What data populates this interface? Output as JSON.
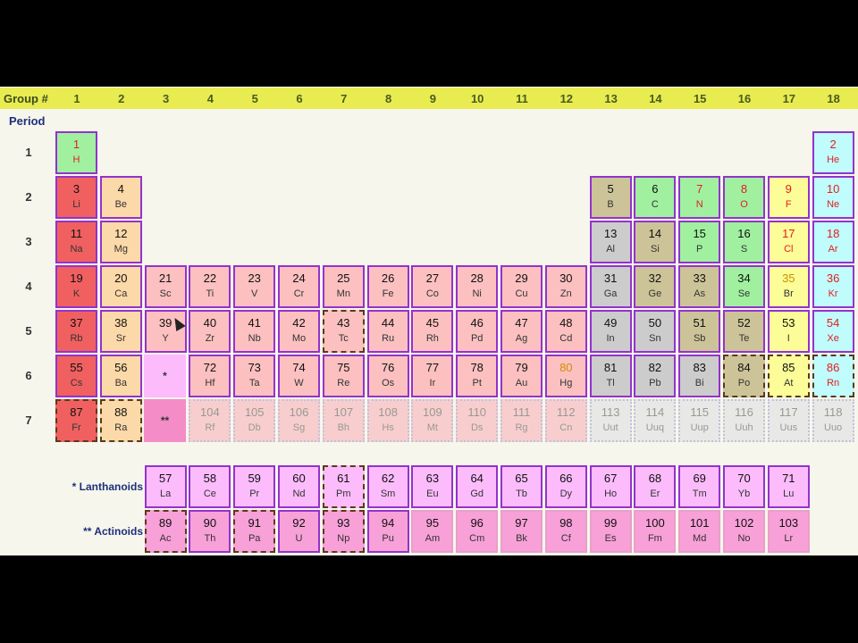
{
  "header": {
    "group_title": "Group #",
    "groups": [
      "1",
      "2",
      "3",
      "4",
      "5",
      "6",
      "7",
      "8",
      "9",
      "10",
      "11",
      "12",
      "13",
      "14",
      "15",
      "16",
      "17",
      "18"
    ]
  },
  "periods": {
    "title": "Period",
    "labels": [
      "1",
      "2",
      "3",
      "4",
      "5",
      "6",
      "7"
    ]
  },
  "series": {
    "lanthanoid_marker": "*",
    "actinoid_marker": "**",
    "lanthanoids_label": "* Lanthanoids",
    "actinoids_label": "** Actinoids"
  },
  "elements": [
    [
      1,
      "H",
      1,
      1,
      "nonmetal",
      "g",
      "solid"
    ],
    [
      2,
      "He",
      18,
      1,
      "noble",
      "g",
      "solid"
    ],
    [
      3,
      "Li",
      1,
      2,
      "alkali",
      "s",
      "solid"
    ],
    [
      4,
      "Be",
      2,
      2,
      "alkaline",
      "s",
      "solid"
    ],
    [
      5,
      "B",
      13,
      2,
      "metalloid",
      "s",
      "solid"
    ],
    [
      6,
      "C",
      14,
      2,
      "nonmetal",
      "s",
      "solid"
    ],
    [
      7,
      "N",
      15,
      2,
      "nonmetal",
      "g",
      "solid"
    ],
    [
      8,
      "O",
      16,
      2,
      "nonmetal",
      "g",
      "solid"
    ],
    [
      9,
      "F",
      17,
      2,
      "halogen",
      "g",
      "solid"
    ],
    [
      10,
      "Ne",
      18,
      2,
      "noble",
      "g",
      "solid"
    ],
    [
      11,
      "Na",
      1,
      3,
      "alkali",
      "s",
      "solid"
    ],
    [
      12,
      "Mg",
      2,
      3,
      "alkaline",
      "s",
      "solid"
    ],
    [
      13,
      "Al",
      13,
      3,
      "post",
      "s",
      "solid"
    ],
    [
      14,
      "Si",
      14,
      3,
      "metalloid",
      "s",
      "solid"
    ],
    [
      15,
      "P",
      15,
      3,
      "nonmetal",
      "s",
      "solid"
    ],
    [
      16,
      "S",
      16,
      3,
      "nonmetal",
      "s",
      "solid"
    ],
    [
      17,
      "Cl",
      17,
      3,
      "halogen",
      "g",
      "solid"
    ],
    [
      18,
      "Ar",
      18,
      3,
      "noble",
      "g",
      "solid"
    ],
    [
      19,
      "K",
      1,
      4,
      "alkali",
      "s",
      "solid"
    ],
    [
      20,
      "Ca",
      2,
      4,
      "alkaline",
      "s",
      "solid"
    ],
    [
      21,
      "Sc",
      3,
      4,
      "transition",
      "s",
      "solid"
    ],
    [
      22,
      "Ti",
      4,
      4,
      "transition",
      "s",
      "solid"
    ],
    [
      23,
      "V",
      5,
      4,
      "transition",
      "s",
      "solid"
    ],
    [
      24,
      "Cr",
      6,
      4,
      "transition",
      "s",
      "solid"
    ],
    [
      25,
      "Mn",
      7,
      4,
      "transition",
      "s",
      "solid"
    ],
    [
      26,
      "Fe",
      8,
      4,
      "transition",
      "s",
      "solid"
    ],
    [
      27,
      "Co",
      9,
      4,
      "transition",
      "s",
      "solid"
    ],
    [
      28,
      "Ni",
      10,
      4,
      "transition",
      "s",
      "solid"
    ],
    [
      29,
      "Cu",
      11,
      4,
      "transition",
      "s",
      "solid"
    ],
    [
      30,
      "Zn",
      12,
      4,
      "transition",
      "s",
      "solid"
    ],
    [
      31,
      "Ga",
      13,
      4,
      "post",
      "s",
      "solid"
    ],
    [
      32,
      "Ge",
      14,
      4,
      "metalloid",
      "s",
      "solid"
    ],
    [
      33,
      "As",
      15,
      4,
      "metalloid",
      "s",
      "solid"
    ],
    [
      34,
      "Se",
      16,
      4,
      "nonmetal",
      "s",
      "solid"
    ],
    [
      35,
      "Br",
      17,
      4,
      "halogen",
      "l",
      "solid"
    ],
    [
      36,
      "Kr",
      18,
      4,
      "noble",
      "g",
      "solid"
    ],
    [
      37,
      "Rb",
      1,
      5,
      "alkali",
      "s",
      "solid"
    ],
    [
      38,
      "Sr",
      2,
      5,
      "alkaline",
      "s",
      "solid"
    ],
    [
      39,
      "Y",
      3,
      5,
      "transition",
      "s",
      "solid"
    ],
    [
      40,
      "Zr",
      4,
      5,
      "transition",
      "s",
      "solid"
    ],
    [
      41,
      "Nb",
      5,
      5,
      "transition",
      "s",
      "solid"
    ],
    [
      42,
      "Mo",
      6,
      5,
      "transition",
      "s",
      "solid"
    ],
    [
      43,
      "Tc",
      7,
      5,
      "transition",
      "s",
      "dashed"
    ],
    [
      44,
      "Ru",
      8,
      5,
      "transition",
      "s",
      "solid"
    ],
    [
      45,
      "Rh",
      9,
      5,
      "transition",
      "s",
      "solid"
    ],
    [
      46,
      "Pd",
      10,
      5,
      "transition",
      "s",
      "solid"
    ],
    [
      47,
      "Ag",
      11,
      5,
      "transition",
      "s",
      "solid"
    ],
    [
      48,
      "Cd",
      12,
      5,
      "transition",
      "s",
      "solid"
    ],
    [
      49,
      "In",
      13,
      5,
      "post",
      "s",
      "solid"
    ],
    [
      50,
      "Sn",
      14,
      5,
      "post",
      "s",
      "solid"
    ],
    [
      51,
      "Sb",
      15,
      5,
      "metalloid",
      "s",
      "solid"
    ],
    [
      52,
      "Te",
      16,
      5,
      "metalloid",
      "s",
      "solid"
    ],
    [
      53,
      "I",
      17,
      5,
      "halogen",
      "s",
      "solid"
    ],
    [
      54,
      "Xe",
      18,
      5,
      "noble",
      "g",
      "solid"
    ],
    [
      55,
      "Cs",
      1,
      6,
      "alkali",
      "s",
      "solid"
    ],
    [
      56,
      "Ba",
      2,
      6,
      "alkaline",
      "s",
      "solid"
    ],
    [
      72,
      "Hf",
      4,
      6,
      "transition",
      "s",
      "solid"
    ],
    [
      73,
      "Ta",
      5,
      6,
      "transition",
      "s",
      "solid"
    ],
    [
      74,
      "W",
      6,
      6,
      "transition",
      "s",
      "solid"
    ],
    [
      75,
      "Re",
      7,
      6,
      "transition",
      "s",
      "solid"
    ],
    [
      76,
      "Os",
      8,
      6,
      "transition",
      "s",
      "solid"
    ],
    [
      77,
      "Ir",
      9,
      6,
      "transition",
      "s",
      "solid"
    ],
    [
      78,
      "Pt",
      10,
      6,
      "transition",
      "s",
      "solid"
    ],
    [
      79,
      "Au",
      11,
      6,
      "transition",
      "s",
      "solid"
    ],
    [
      80,
      "Hg",
      12,
      6,
      "transition",
      "l",
      "solid"
    ],
    [
      81,
      "Tl",
      13,
      6,
      "post",
      "s",
      "solid"
    ],
    [
      82,
      "Pb",
      14,
      6,
      "post",
      "s",
      "solid"
    ],
    [
      83,
      "Bi",
      15,
      6,
      "post",
      "s",
      "solid"
    ],
    [
      84,
      "Po",
      16,
      6,
      "metalloid",
      "s",
      "dashed"
    ],
    [
      85,
      "At",
      17,
      6,
      "halogen",
      "s",
      "dashed"
    ],
    [
      86,
      "Rn",
      18,
      6,
      "noble",
      "g",
      "dashed"
    ],
    [
      87,
      "Fr",
      1,
      7,
      "alkali",
      "s",
      "dashed"
    ],
    [
      88,
      "Ra",
      2,
      7,
      "alkaline",
      "s",
      "dashed"
    ],
    [
      104,
      "Rf",
      4,
      7,
      "trans7",
      "u",
      "dotted"
    ],
    [
      105,
      "Db",
      5,
      7,
      "trans7",
      "u",
      "dotted"
    ],
    [
      106,
      "Sg",
      6,
      7,
      "trans7",
      "u",
      "dotted"
    ],
    [
      107,
      "Bh",
      7,
      7,
      "trans7",
      "u",
      "dotted"
    ],
    [
      108,
      "Hs",
      8,
      7,
      "trans7",
      "u",
      "dotted"
    ],
    [
      109,
      "Mt",
      9,
      7,
      "trans7",
      "u",
      "dotted"
    ],
    [
      110,
      "Ds",
      10,
      7,
      "trans7",
      "u",
      "dotted"
    ],
    [
      111,
      "Rg",
      11,
      7,
      "trans7",
      "u",
      "dotted"
    ],
    [
      112,
      "Cn",
      12,
      7,
      "trans7",
      "u",
      "dotted"
    ],
    [
      113,
      "Uut",
      13,
      7,
      "unknown",
      "u",
      "dotted"
    ],
    [
      114,
      "Uuq",
      14,
      7,
      "unknown",
      "u",
      "dotted"
    ],
    [
      115,
      "Uup",
      15,
      7,
      "unknown",
      "u",
      "dotted"
    ],
    [
      116,
      "Uuh",
      16,
      7,
      "unknown",
      "u",
      "dotted"
    ],
    [
      117,
      "Uus",
      17,
      7,
      "unknown",
      "u",
      "dotted"
    ],
    [
      118,
      "Uuo",
      18,
      7,
      "unknown",
      "u",
      "dotted"
    ],
    [
      57,
      "La",
      3,
      "L",
      "lanth",
      "s",
      "solid"
    ],
    [
      58,
      "Ce",
      4,
      "L",
      "lanth",
      "s",
      "solid"
    ],
    [
      59,
      "Pr",
      5,
      "L",
      "lanth",
      "s",
      "solid"
    ],
    [
      60,
      "Nd",
      6,
      "L",
      "lanth",
      "s",
      "solid"
    ],
    [
      61,
      "Pm",
      7,
      "L",
      "lanth",
      "s",
      "dashed"
    ],
    [
      62,
      "Sm",
      8,
      "L",
      "lanth",
      "s",
      "solid"
    ],
    [
      63,
      "Eu",
      9,
      "L",
      "lanth",
      "s",
      "solid"
    ],
    [
      64,
      "Gd",
      10,
      "L",
      "lanth",
      "s",
      "solid"
    ],
    [
      65,
      "Tb",
      11,
      "L",
      "lanth",
      "s",
      "solid"
    ],
    [
      66,
      "Dy",
      12,
      "L",
      "lanth",
      "s",
      "solid"
    ],
    [
      67,
      "Ho",
      13,
      "L",
      "lanth",
      "s",
      "solid"
    ],
    [
      68,
      "Er",
      14,
      "L",
      "lanth",
      "s",
      "solid"
    ],
    [
      69,
      "Tm",
      15,
      "L",
      "lanth",
      "s",
      "solid"
    ],
    [
      70,
      "Yb",
      16,
      "L",
      "lanth",
      "s",
      "solid"
    ],
    [
      71,
      "Lu",
      17,
      "L",
      "lanth",
      "s",
      "solid"
    ],
    [
      89,
      "Ac",
      3,
      "A",
      "actin",
      "s",
      "dashed"
    ],
    [
      90,
      "Th",
      4,
      "A",
      "actin",
      "s",
      "solid"
    ],
    [
      91,
      "Pa",
      5,
      "A",
      "actin",
      "s",
      "dashed"
    ],
    [
      92,
      "U",
      6,
      "A",
      "actin",
      "s",
      "solid"
    ],
    [
      93,
      "Np",
      7,
      "A",
      "actin",
      "s",
      "dashed"
    ],
    [
      94,
      "Pu",
      8,
      "A",
      "actin",
      "s",
      "solid"
    ],
    [
      95,
      "Am",
      9,
      "A",
      "actin",
      "s",
      "thin"
    ],
    [
      96,
      "Cm",
      10,
      "A",
      "actin",
      "s",
      "thin"
    ],
    [
      97,
      "Bk",
      11,
      "A",
      "actin",
      "s",
      "thin"
    ],
    [
      98,
      "Cf",
      12,
      "A",
      "actin",
      "s",
      "thin"
    ],
    [
      99,
      "Es",
      13,
      "A",
      "actin",
      "s",
      "thin"
    ],
    [
      100,
      "Fm",
      14,
      "A",
      "actin",
      "s",
      "thin"
    ],
    [
      101,
      "Md",
      15,
      "A",
      "actin",
      "s",
      "thin"
    ],
    [
      102,
      "No",
      16,
      "A",
      "actin",
      "s",
      "thin"
    ],
    [
      103,
      "Lr",
      17,
      "A",
      "actin",
      "s",
      "thin"
    ]
  ]
}
